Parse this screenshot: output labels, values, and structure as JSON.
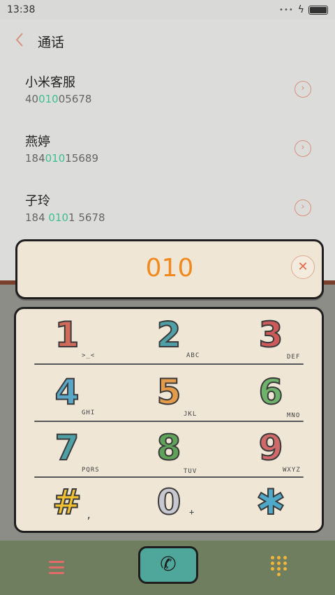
{
  "status": {
    "time": "13:38",
    "dots": "•••",
    "bolt": "ϟ"
  },
  "header": {
    "title": "通话"
  },
  "contacts": [
    {
      "name": "小米客服",
      "pre": "40",
      "hl": "010",
      "post": "05678"
    },
    {
      "name": "燕婷",
      "pre": "184",
      "hl": "010",
      "post": "15689"
    },
    {
      "name": "子玲",
      "pre": "184 ",
      "hl": "010",
      "post": "1 5678"
    }
  ],
  "display": {
    "digits": "010",
    "clear": "✕"
  },
  "keys": [
    {
      "digit": "1",
      "letters": ">_<",
      "color": "#d06a5a"
    },
    {
      "digit": "2",
      "letters": "ABC",
      "color": "#4f9fa6"
    },
    {
      "digit": "3",
      "letters": "DEF",
      "color": "#cc5a5a"
    },
    {
      "digit": "4",
      "letters": "GHI",
      "color": "#5aa6c9"
    },
    {
      "digit": "5",
      "letters": "JKL",
      "color": "#e39b4a"
    },
    {
      "digit": "6",
      "letters": "MNO",
      "color": "#6fb26b"
    },
    {
      "digit": "7",
      "letters": "PQRS",
      "color": "#4f9fa6"
    },
    {
      "digit": "8",
      "letters": "TUV",
      "color": "#5fa35a"
    },
    {
      "digit": "9",
      "letters": "WXYZ",
      "color": "#d06a6a"
    },
    {
      "digit": "#",
      "letters": ",",
      "color": "#f2c233"
    },
    {
      "digit": "0",
      "letters": "+",
      "color": "#c8c8d0"
    },
    {
      "digit": "✱",
      "letters": "",
      "color": "#4fa9c9"
    }
  ],
  "call": {
    "icon": "✆"
  }
}
